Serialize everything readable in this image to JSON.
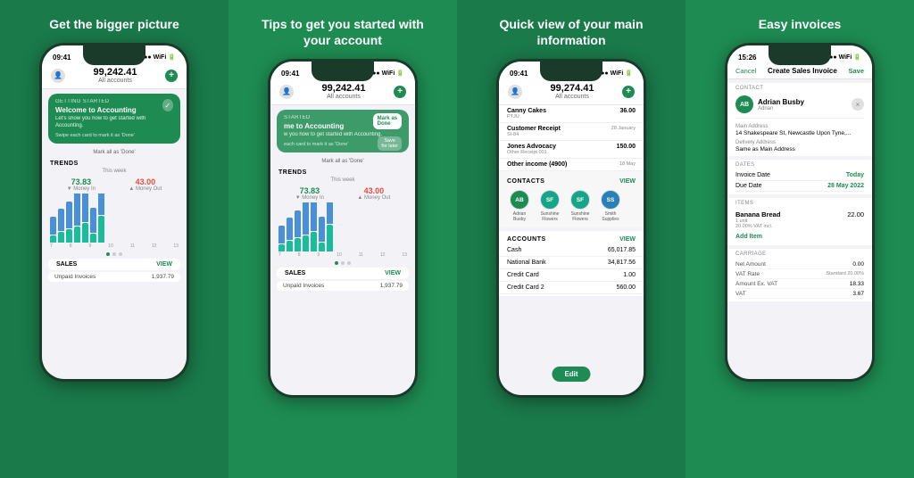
{
  "panels": [
    {
      "id": "panel-1",
      "title": "Get the bigger picture",
      "background": "#1a7a4a",
      "phone": {
        "status_time": "09:41",
        "balance": "99,242.41",
        "balance_label": "All accounts",
        "getting_started_label": "GETTING STARTED",
        "card_title": "Welcome to Accounting",
        "card_subtitle": "Let's show you how to get started with Accounting.",
        "swipe_hint": "Swipe each card to mark it as 'Done'",
        "mark_all_done": "Mark all as 'Done'",
        "trends_label": "TRENDS",
        "trends_week": "This week",
        "trend_in_amount": "73.83",
        "trend_in_label": "▼ Money In",
        "trend_out_amount": "43.00",
        "trend_out_label": "▲ Money Out",
        "chart_labels": [
          "7",
          "8",
          "9",
          "10",
          "11",
          "12",
          "13"
        ],
        "bars": [
          {
            "blue": 20,
            "teal": 8
          },
          {
            "blue": 25,
            "teal": 12
          },
          {
            "blue": 30,
            "teal": 15
          },
          {
            "blue": 40,
            "teal": 18
          },
          {
            "blue": 35,
            "teal": 22
          },
          {
            "blue": 28,
            "teal": 10
          },
          {
            "blue": 45,
            "teal": 30
          }
        ],
        "sales_label": "SALES",
        "sales_view": "VIEW",
        "invoice_label": "Unpaid Invoices",
        "invoice_amount": "1,937.79"
      }
    },
    {
      "id": "panel-2",
      "title": "Tips to get you started with your account",
      "background": "#1e8c52",
      "phone": {
        "status_time": "09:41",
        "balance": "99,242.41",
        "balance_label": "All accounts",
        "getting_started_label": "STARTED",
        "card_title": "me to Accounting",
        "card_subtitle": "w you how to get started with Accounting.",
        "mark_as_done_text": "Mark as\nDone'",
        "save_for_later": "Save\nfor later",
        "swipe_hint": "each card to mark it as 'Done'",
        "mark_all_done": "Mark all as 'Done'",
        "trends_label": "TRENDS",
        "trends_week": "This week",
        "trend_in_amount": "73.83",
        "trend_in_label": "▼ Money In",
        "trend_out_amount": "43.00",
        "trend_out_label": "▲ Money Out",
        "sales_label": "SALES",
        "sales_view": "VIEW",
        "invoice_label": "Unpaid Invoices",
        "invoice_amount": "1,937.79"
      }
    },
    {
      "id": "panel-3",
      "title": "Quick view of your main information",
      "background": "#1a7a4a",
      "phone": {
        "status_time": "09:41",
        "balance": "99,274.41",
        "balance_label": "All accounts",
        "transactions": [
          {
            "name": "Canny Cakes",
            "sub": "PTJU",
            "amount": "36.00",
            "date": ""
          },
          {
            "name": "Customer Receipt",
            "sub": "SI-84",
            "amount": "",
            "date": "28 January"
          },
          {
            "name": "Jones Advocacy",
            "sub": "Other Receipt  001",
            "amount": "150.00",
            "date": ""
          },
          {
            "name": "Other income (4900)",
            "sub": "",
            "amount": "",
            "date": "18 May"
          }
        ],
        "contacts_label": "CONTACTS",
        "contacts_view": "VIEW",
        "contacts": [
          {
            "initials": "AB",
            "name": "Adrian Busby",
            "color": "av-green"
          },
          {
            "initials": "SF",
            "name": "Sunshine Flowers",
            "color": "av-teal"
          },
          {
            "initials": "SF",
            "name": "Sunshine Flowers",
            "color": "av-teal"
          },
          {
            "initials": "SS",
            "name": "Smith Supplies",
            "color": "av-blue"
          }
        ],
        "accounts_label": "ACCOUNTS",
        "accounts_view": "VIEW",
        "accounts": [
          {
            "name": "Cash",
            "amount": "65,017.85"
          },
          {
            "name": "National Bank",
            "amount": "34,817.56"
          },
          {
            "name": "Credit Card",
            "amount": "1.00"
          },
          {
            "name": "Credit Card 2",
            "amount": "560.00"
          }
        ],
        "edit_button": "Edit"
      }
    },
    {
      "id": "panel-4",
      "title": "Easy invoices",
      "background": "#1e8c52",
      "phone": {
        "status_time": "15:26",
        "cancel_label": "Cancel",
        "form_title": "Create Sales Invoice",
        "save_label": "Save",
        "contact_section": "CONTACT",
        "contact_initials": "AB",
        "contact_name": "Adrian Busby",
        "contact_sub": "Adrian",
        "main_address_label": "Main Address",
        "main_address": "14 Shakespeare St, Newcastle Upon Tyne,...",
        "delivery_address_label": "Delivery Address",
        "delivery_address": "Same as Main Address",
        "dates_label": "DATES",
        "invoice_date_label": "Invoice Date",
        "invoice_date_value": "Today",
        "due_date_label": "Due Date",
        "due_date_value": "28 May 2022",
        "items_label": "ITEMS",
        "item_name": "Banana Bread",
        "item_sub": "1 unit",
        "item_tax": "20.00% VAT incl.",
        "item_price": "22.00",
        "add_item_label": "Add Item",
        "carriage_label": "CARRIAGE",
        "net_amount_label": "Net Amount",
        "net_amount_value": "0.00",
        "vat_rate_label": "VAT Rate",
        "vat_rate_value": "Standard 20.00%",
        "vat_ex_label": "Amount Ex. VAT",
        "vat_ex_value": "18.33",
        "vat_label": "VAT",
        "vat_value": "3.67"
      }
    }
  ]
}
